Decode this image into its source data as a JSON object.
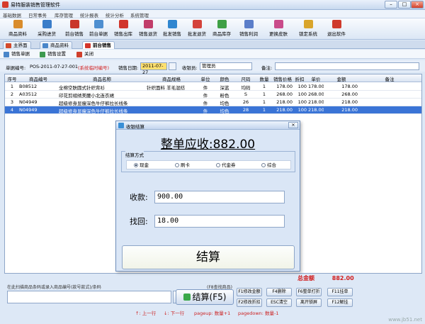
{
  "window": {
    "title": "易特服装销售管理软件"
  },
  "menu": [
    "基础数据",
    "日常事务",
    "库存管理",
    "统计报表",
    "统计分析",
    "系统管理"
  ],
  "toolbar": [
    {
      "label": "商品资料",
      "icon": "box-icon",
      "color": "#d98c2b"
    },
    {
      "label": "采购进货",
      "icon": "cart-icon",
      "color": "#3a7dc9"
    },
    {
      "label": "前台销售",
      "icon": "register-icon",
      "color": "#c9362b"
    },
    {
      "label": "前台单据",
      "icon": "receipt-icon",
      "color": "#4f8fd0"
    },
    {
      "label": "销售出库",
      "icon": "outbox-icon",
      "color": "#d1352b"
    },
    {
      "label": "销售退货",
      "icon": "return-icon",
      "color": "#c13d6a"
    },
    {
      "label": "批发销售",
      "icon": "wholesale-icon",
      "color": "#2f86d0"
    },
    {
      "label": "批发退货",
      "icon": "wholesale-return-icon",
      "color": "#d4433b"
    },
    {
      "label": "商品库存",
      "icon": "stock-icon",
      "color": "#3fa046"
    },
    {
      "label": "销售利润",
      "icon": "profit-icon",
      "color": "#5b7ec9"
    },
    {
      "label": "更换皮肤",
      "icon": "skin-icon",
      "color": "#c94b8a"
    },
    {
      "label": "锁定系统",
      "icon": "lock-icon",
      "color": "#d9a52b"
    },
    {
      "label": "退出软件",
      "icon": "exit-icon",
      "color": "#cf3a2c"
    }
  ],
  "tabs": [
    {
      "label": "主界面",
      "active": false,
      "color": "#d34a2c"
    },
    {
      "label": "商品资料",
      "active": false,
      "color": "#4a86c9"
    },
    {
      "label": "前台销售",
      "active": true,
      "color": "#d3352b"
    }
  ],
  "subtoolbar": [
    {
      "label": "销售单据",
      "color": "#4a86c9"
    },
    {
      "label": "销售设置",
      "color": "#3d9a50"
    },
    {
      "label": "关闭",
      "color": "#d0402c"
    }
  ],
  "order": {
    "no_label": "单据编号:",
    "no_value": "POS-2011-07-27-001",
    "no_note": "(系统临时编号)",
    "date_label": "销售日期:",
    "date_value": "2011-07-27",
    "cashier_label": "收银员:",
    "cashier_value": "管理员",
    "remark_label": "备注:"
  },
  "table": {
    "headers": [
      "序号",
      "商品编号",
      "商品名称",
      "商品规格",
      "单位",
      "颜色",
      "尺码",
      "数量",
      "销售价格",
      "折扣",
      "单价",
      "金额",
      "备注"
    ],
    "rows": [
      [
        "1",
        "B08512",
        "全棉空肤圆式针织背衫",
        "针织面料 羊毛混纺",
        "件",
        "深蓝",
        "均码",
        "1",
        "178.00",
        "100",
        "178.00",
        "178.00",
        ""
      ],
      [
        "2",
        "A03512",
        "印花剪褶绣美腰小北连衣裙",
        "",
        "件",
        "粉色",
        "S",
        "1",
        "268.00",
        "100",
        "268.00",
        "268.00",
        ""
      ],
      [
        "3",
        "N04949",
        "超级修身显瘦深色牛仔裤拉长线条",
        "",
        "件",
        "均色",
        "26",
        "1",
        "218.00",
        "100",
        "218.00",
        "218.00",
        ""
      ],
      [
        "4",
        "N04949",
        "超级修身显瘦深色牛仔裤拉长线条",
        "",
        "件",
        "均色",
        "28",
        "1",
        "218.00",
        "100",
        "218.00",
        "218.00",
        ""
      ]
    ],
    "selected_row": 3
  },
  "totals": {
    "label": "总金额",
    "value": "882.00"
  },
  "scan": {
    "hint": "在此扫描商品条码或录入商品编号(款号款式)/条码",
    "hint2": "(F8查找商品)",
    "settle_label": "结算(F5)",
    "fkeys": [
      "F1修改金额",
      "F4删除",
      "F6整单打折",
      "F11挂单",
      "F2修改折扣",
      "ESC清空",
      "离开锁屏",
      "F12解挂"
    ],
    "nav_up": "↑: 上一行",
    "nav_down": "↓: 下一行",
    "pageup": "pageup: 数量+1",
    "pagedown": "pagedown: 数量-1"
  },
  "dialog": {
    "title": "收银结算",
    "close": "×",
    "heading": "整单应收:882.00",
    "pay_legend": "结算方式",
    "pay_options": [
      {
        "label": "现金",
        "checked": true
      },
      {
        "label": "刷卡",
        "checked": false
      },
      {
        "label": "代金券",
        "checked": false
      },
      {
        "label": "综合",
        "checked": false
      }
    ],
    "received_label": "收款:",
    "received_value": "900.00",
    "change_label": "找回:",
    "change_value": "18.00",
    "settle_button": "结算"
  },
  "watermark": "www.jb51.net"
}
